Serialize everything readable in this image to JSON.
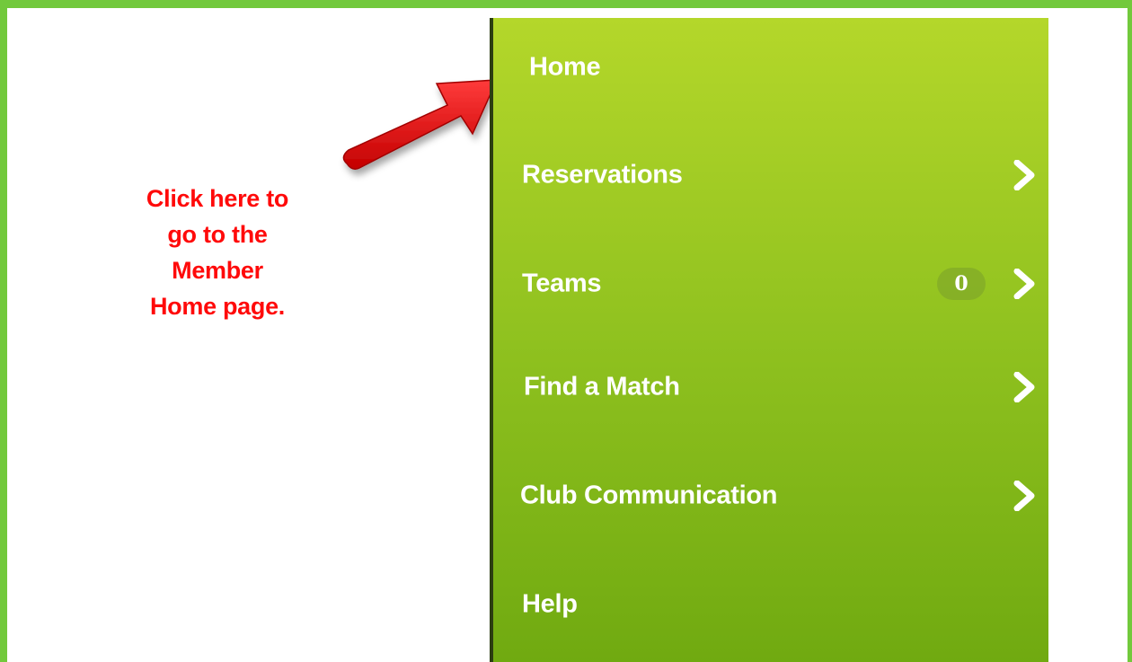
{
  "annotation": {
    "text": "Click here to\ngo to the\nMember\nHome page.",
    "color": "#ff0a0a"
  },
  "menu": {
    "accent_top": "#b4d72a",
    "accent_bottom": "#6fa910",
    "items": [
      {
        "label": "Home",
        "has_chevron": false,
        "icon": ""
      },
      {
        "label": "Reservations",
        "has_chevron": true,
        "icon": "chevron-right-icon"
      },
      {
        "label": "Teams",
        "has_chevron": true,
        "icon": "chevron-right-icon",
        "badge": "0"
      },
      {
        "label": "Find a Match",
        "has_chevron": true,
        "icon": "chevron-right-icon"
      },
      {
        "label": "Club Communication",
        "has_chevron": true,
        "icon": "chevron-right-icon"
      },
      {
        "label": "Help",
        "has_chevron": false,
        "icon": ""
      }
    ]
  },
  "frame_color": "#72c93c"
}
